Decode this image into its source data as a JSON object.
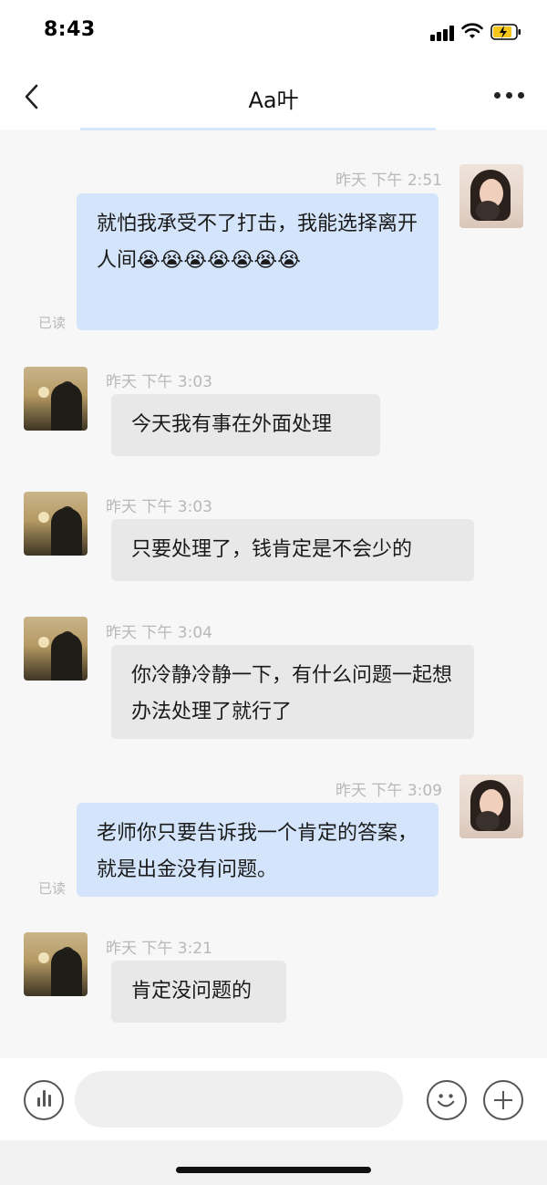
{
  "status_bar": {
    "time": "8:43"
  },
  "header": {
    "title": "Aa叶"
  },
  "messages": [
    {
      "direction": "out",
      "timestamp": "昨天 下午 2:51",
      "text": "就怕我承受不了打击，我能选择离开人间😭😭😭😭😭😭😭",
      "read": "已读"
    },
    {
      "direction": "in",
      "timestamp": "昨天 下午 3:03",
      "text": "今天我有事在外面处理"
    },
    {
      "direction": "in",
      "timestamp": "昨天 下午 3:03",
      "text": "只要处理了，钱肯定是不会少的"
    },
    {
      "direction": "in",
      "timestamp": "昨天 下午 3:04",
      "text": "你冷静冷静一下，有什么问题一起想办法处理了就行了"
    },
    {
      "direction": "out",
      "timestamp": "昨天 下午 3:09",
      "text": "老师你只要告诉我一个肯定的答案，就是出金没有问题。",
      "read": "已读"
    },
    {
      "direction": "in",
      "timestamp": "昨天 下午 3:21",
      "text": "肯定没问题的"
    }
  ],
  "input": {
    "value": "",
    "placeholder": ""
  },
  "icons": [
    "back-arrow-icon",
    "more-dots-icon",
    "voice-icon",
    "emoji-icon",
    "plus-icon"
  ],
  "colors": {
    "outgoing_bubble": "#d4e5fb",
    "incoming_bubble": "#e8e8e8",
    "background": "#f7f7f7"
  }
}
